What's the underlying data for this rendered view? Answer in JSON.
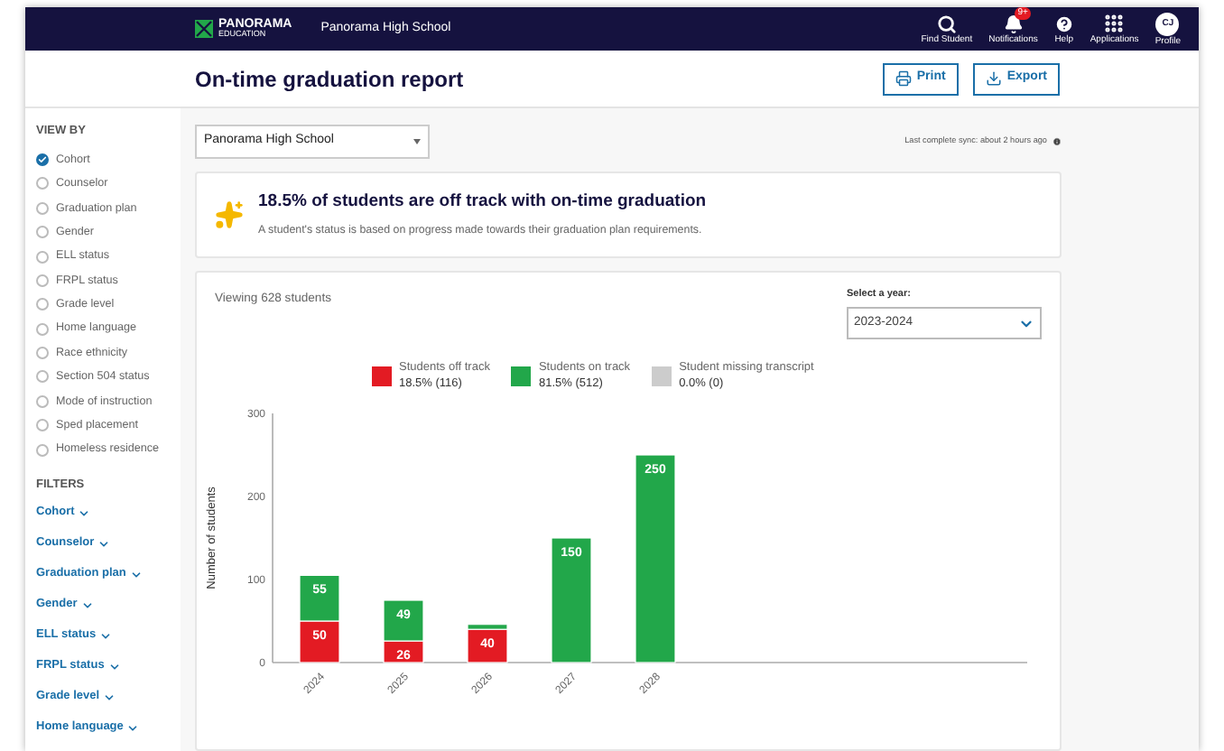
{
  "nav": {
    "logo": {
      "name": "PANORAMA",
      "sub": "EDUCATION"
    },
    "school": "Panorama High School",
    "actions": [
      {
        "kind": "search",
        "label": "Find Student"
      },
      {
        "kind": "bell",
        "label": "Notifications",
        "badge": "9+"
      },
      {
        "kind": "help",
        "label": "Help"
      },
      {
        "kind": "grid",
        "label": "Applications"
      },
      {
        "kind": "profile",
        "label": "Profile",
        "initials": "CJ"
      }
    ]
  },
  "header": {
    "title": "On-time graduation report",
    "buttons": [
      {
        "kind": "print",
        "label": "Print"
      },
      {
        "kind": "export",
        "label": "Export"
      }
    ]
  },
  "sidebar": {
    "view_by": {
      "title": "VIEW BY",
      "options": [
        {
          "label": "Cohort",
          "selected": true
        },
        {
          "label": "Counselor",
          "selected": false
        },
        {
          "label": "Graduation plan",
          "selected": false
        },
        {
          "label": "Gender",
          "selected": false
        },
        {
          "label": "ELL status",
          "selected": false
        },
        {
          "label": "FRPL status",
          "selected": false
        },
        {
          "label": "Grade level",
          "selected": false
        },
        {
          "label": "Home language",
          "selected": false
        },
        {
          "label": "Race ethnicity",
          "selected": false
        },
        {
          "label": "Section 504 status",
          "selected": false
        },
        {
          "label": "Mode of instruction",
          "selected": false
        },
        {
          "label": "Sped placement",
          "selected": false
        },
        {
          "label": "Homeless residence",
          "selected": false
        }
      ]
    },
    "filters": {
      "title": "FILTERS",
      "items": [
        "Cohort",
        "Counselor",
        "Graduation plan",
        "Gender",
        "ELL status",
        "FRPL status",
        "Grade level",
        "Home language"
      ]
    }
  },
  "school_select": {
    "value": "Panorama High School"
  },
  "sync": "Last complete sync: about 2 hours ago",
  "insight": {
    "title": "18.5% of students are off track with on-time graduation",
    "text": "A student's status is based on progress made towards their graduation plan requirements."
  },
  "report": {
    "viewing": "Viewing 628 students",
    "year_select": {
      "label": "Select a year:",
      "value": "2023-2024"
    },
    "legend_values": [
      "18.5% (116)",
      "81.5% (512)",
      "0.0% (0)"
    ],
    "chart_data": {
      "type": "bar",
      "stacked": true,
      "ylabel": "Number of students",
      "categories": [
        "2024",
        "2025",
        "2026",
        "2027",
        "2028"
      ],
      "series": [
        {
          "name": "Students off track",
          "color": "#e31b23",
          "values": [
            50,
            26,
            40,
            0,
            0
          ]
        },
        {
          "name": "Students on track",
          "color": "#22a74a",
          "values": [
            55,
            49,
            6,
            150,
            250
          ]
        },
        {
          "name": "Student missing transcript",
          "color": "#cccccc",
          "values": [
            0,
            0,
            0,
            0,
            0
          ]
        }
      ],
      "ylim": [
        0,
        300
      ],
      "yticks": [
        0,
        100,
        200,
        300
      ],
      "value_labels": [
        [
          "50",
          "26",
          "40",
          null,
          null
        ],
        [
          "55",
          "49",
          null,
          "150",
          "250"
        ],
        [
          null,
          null,
          null,
          null,
          null
        ]
      ]
    }
  }
}
